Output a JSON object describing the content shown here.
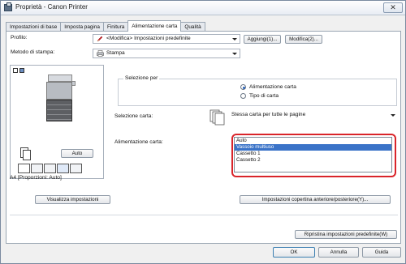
{
  "window": {
    "title": "Proprietà - Canon Printer",
    "close_label": "✕"
  },
  "tabs": [
    {
      "label": "Impostazioni di base",
      "active": false
    },
    {
      "label": "Imposta pagina",
      "active": false
    },
    {
      "label": "Finitura",
      "active": false
    },
    {
      "label": "Alimentazione carta",
      "active": true
    },
    {
      "label": "Qualità",
      "active": false
    }
  ],
  "profile": {
    "label": "Profilo:",
    "value": "<Modifica> Impostazioni predefinite",
    "add_button": "Aggiungi(1)...",
    "edit_button": "Modifica(2)..."
  },
  "output_method": {
    "label": "Metodo di stampa:",
    "value": "Stampa"
  },
  "preview": {
    "auto_button": "Auto",
    "status_text": "A4 [Proporzioni: Auto]",
    "view_settings_button": "Visualizza impostazioni"
  },
  "paper_selection": {
    "legend": "Selezione per",
    "options": [
      {
        "label": "Alimentazione carta",
        "checked": true
      },
      {
        "label": "Tipo di carta",
        "checked": false
      }
    ]
  },
  "paper_select": {
    "label": "Selezione carta:",
    "value": "Stessa carta per tutte le pagine"
  },
  "paper_source": {
    "label": "Alimentazione carta:",
    "items": [
      {
        "label": "Auto",
        "selected": false
      },
      {
        "label": "Vassoio multiuso",
        "selected": true
      },
      {
        "label": "Cassetto 1",
        "selected": false
      },
      {
        "label": "Cassetto 2",
        "selected": false
      }
    ]
  },
  "cover_button": "Impostazioni copertina anteriore/posteriore(Y)...",
  "restore_button": "Ripristina impostazioni predefinite(W)",
  "footer": {
    "ok": "OK",
    "cancel": "Annulla",
    "help": "Guida"
  },
  "colors": {
    "selection": "#3a73c8",
    "highlight_ring": "#d9242a",
    "tab_border": "#9aa6b3"
  }
}
